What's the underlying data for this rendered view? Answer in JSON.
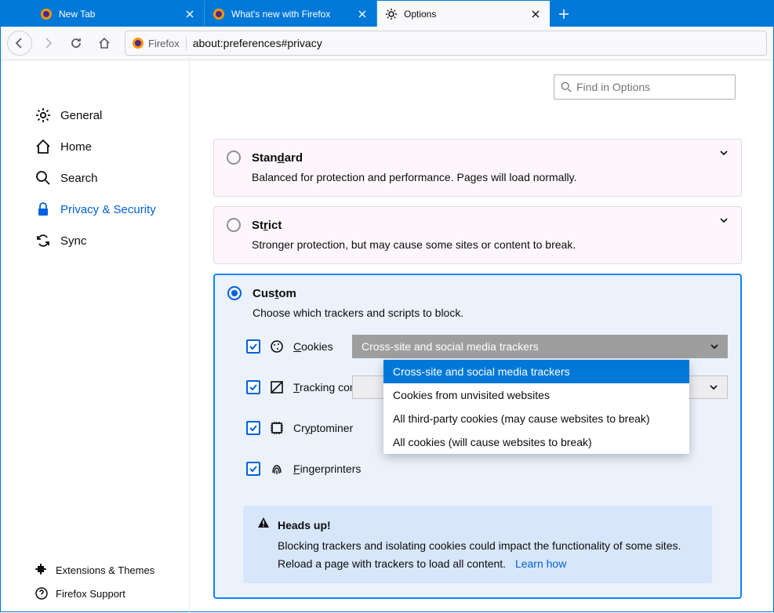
{
  "tabs": [
    {
      "label": "New Tab"
    },
    {
      "label": "What's new with Firefox"
    },
    {
      "label": "Options"
    }
  ],
  "toolbar": {
    "identity_label": "Firefox",
    "url": "about:preferences#privacy"
  },
  "search": {
    "placeholder": "Find in Options"
  },
  "sidebar": {
    "items": [
      {
        "label": "General"
      },
      {
        "label": "Home"
      },
      {
        "label": "Search"
      },
      {
        "label": "Privacy & Security"
      },
      {
        "label": "Sync"
      }
    ],
    "footer": [
      {
        "label": "Extensions & Themes"
      },
      {
        "label": "Firefox Support"
      }
    ]
  },
  "protection": {
    "standard": {
      "title_pre": "Stan",
      "title_u": "d",
      "title_post": "ard",
      "desc": "Balanced for protection and performance. Pages will load normally."
    },
    "strict": {
      "title_pre": "St",
      "title_u": "r",
      "title_post": "ict",
      "desc": "Stronger protection, but may cause some sites or content to break."
    },
    "custom": {
      "title_pre": "Cus",
      "title_u": "t",
      "title_post": "om",
      "desc": "Choose which trackers and scripts to block.",
      "cookies": {
        "label_u": "C",
        "label_post": "ookies",
        "selected": "Cross-site and social media trackers"
      },
      "tracking": {
        "label_u": "T",
        "label_post": "racking con"
      },
      "crypto": {
        "label_pre": "Cr",
        "label_u": "y",
        "label_post": "ptominer"
      },
      "finger": {
        "label_u": "F",
        "label_post": "ingerprinters"
      },
      "options": [
        "Cross-site and social media trackers",
        "Cookies from unvisited websites",
        "All third-party cookies (may cause websites to break)",
        "All cookies (will cause websites to break)"
      ]
    }
  },
  "info": {
    "title": "Heads up!",
    "body": "Blocking trackers and isolating cookies could impact the functionality of some sites. Reload a page with trackers to load all content.",
    "link": "Learn how"
  }
}
